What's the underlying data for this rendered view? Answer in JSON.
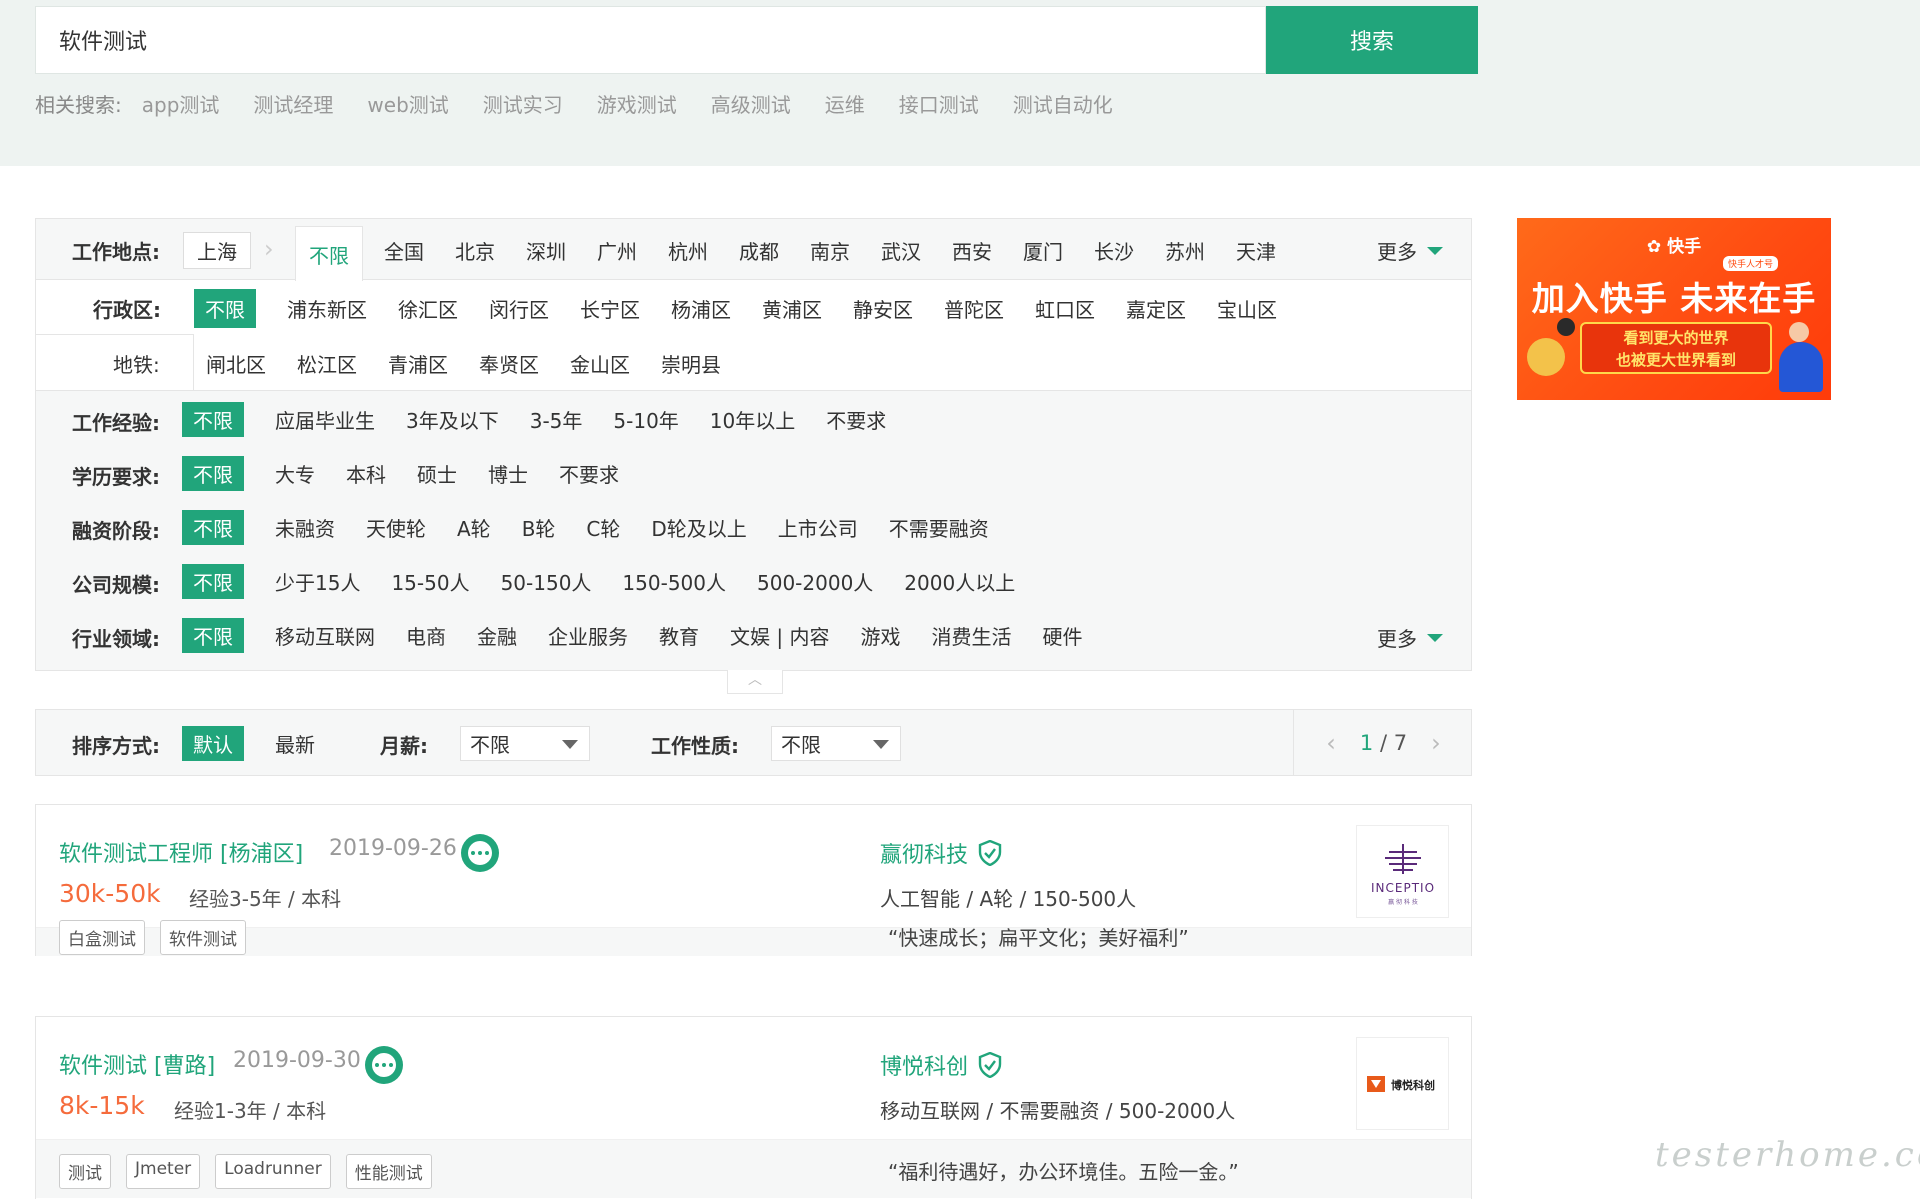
{
  "search": {
    "query": "软件测试",
    "button_label": "搜索",
    "related_label": "相关搜索:",
    "related": [
      "app测试",
      "测试经理",
      "web测试",
      "测试实习",
      "游戏测试",
      "高级测试",
      "运维",
      "接口测试",
      "测试自动化"
    ]
  },
  "filters": {
    "location": {
      "label": "工作地点:",
      "city": "上海",
      "active_tab": "不限",
      "cities": [
        "全国",
        "北京",
        "深圳",
        "广州",
        "杭州",
        "成都",
        "南京",
        "武汉",
        "西安",
        "厦门",
        "长沙",
        "苏州",
        "天津"
      ],
      "more": "更多"
    },
    "district": {
      "label": "行政区:",
      "selected": "不限",
      "options": [
        "浦东新区",
        "徐汇区",
        "闵行区",
        "长宁区",
        "杨浦区",
        "黄浦区",
        "静安区",
        "普陀区",
        "虹口区",
        "嘉定区",
        "宝山区"
      ],
      "options2": [
        "闸北区",
        "松江区",
        "青浦区",
        "奉贤区",
        "金山区",
        "崇明县"
      ]
    },
    "subway": {
      "label": "地铁:"
    },
    "experience": {
      "label": "工作经验:",
      "selected": "不限",
      "options": [
        "应届毕业生",
        "3年及以下",
        "3-5年",
        "5-10年",
        "10年以上",
        "不要求"
      ]
    },
    "education": {
      "label": "学历要求:",
      "selected": "不限",
      "options": [
        "大专",
        "本科",
        "硕士",
        "博士",
        "不要求"
      ]
    },
    "funding": {
      "label": "融资阶段:",
      "selected": "不限",
      "options": [
        "未融资",
        "天使轮",
        "A轮",
        "B轮",
        "C轮",
        "D轮及以上",
        "上市公司",
        "不需要融资"
      ]
    },
    "size": {
      "label": "公司规模:",
      "selected": "不限",
      "options": [
        "少于15人",
        "15-50人",
        "50-150人",
        "150-500人",
        "500-2000人",
        "2000人以上"
      ]
    },
    "industry": {
      "label": "行业领域:",
      "selected": "不限",
      "options": [
        "移动互联网",
        "电商",
        "金融",
        "企业服务",
        "教育",
        "文娱 | 内容",
        "游戏",
        "消费生活",
        "硬件"
      ],
      "more": "更多"
    }
  },
  "sort": {
    "label": "排序方式:",
    "selected": "默认",
    "other": "最新",
    "salary_label": "月薪:",
    "salary_value": "不限",
    "nature_label": "工作性质:",
    "nature_value": "不限",
    "page_current": "1",
    "page_sep": " / ",
    "page_total": "7"
  },
  "jobs": [
    {
      "title": "软件测试工程师 [杨浦区]",
      "date": "2019-09-26",
      "salary": "30k-50k",
      "requirements": "经验3-5年 / 本科",
      "company": "赢彻科技",
      "industry": "人工智能 / A轮 / 150-500人",
      "tags": [
        "白盒测试",
        "软件测试"
      ],
      "welfare": "“快速成长；扁平文化；美好福利”",
      "logo_text": "INCEPTIO",
      "logo_sub": "赢 彻 科 技",
      "logo_color": "#5a2a7a"
    },
    {
      "title": "软件测试 [曹路]",
      "date": "2019-09-30",
      "salary": "8k-15k",
      "requirements": "经验1-3年 / 本科",
      "company": "博悦科创",
      "industry": "移动互联网 / 不需要融资 / 500-2000人",
      "tags": [
        "测试",
        "Jmeter",
        "Loadrunner",
        "性能测试"
      ],
      "welfare": "“福利待遇好，办公环境佳。五险一金。”",
      "logo_text": "博悦科创",
      "logo_color": "#e85a1a"
    }
  ],
  "ad": {
    "brand": "快手",
    "badge": "快手人才号",
    "title": "加入快手 未来在手",
    "slogan_line1": "看到更大的世界",
    "slogan_line2": "也被更大世界看到"
  },
  "watermark": "testerhome.com",
  "colors": {
    "accent": "#21a57b",
    "salary": "#f56b3c",
    "band": "#eef3f1"
  }
}
